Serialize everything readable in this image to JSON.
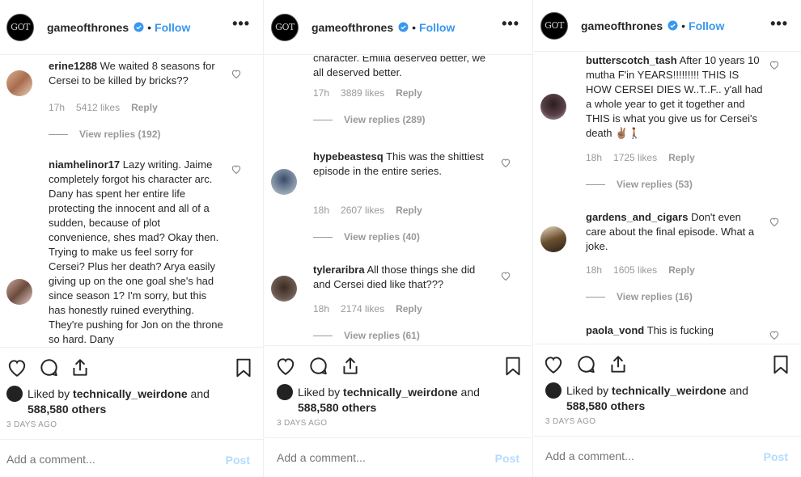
{
  "brand": {
    "logo_text": "GOT",
    "accent": "#3897f0"
  },
  "panels": [
    {
      "header": {
        "username": "gameofthrones",
        "separator": "•",
        "follow": "Follow",
        "more": "•••"
      },
      "comments": [
        {
          "user": "erine1288",
          "text": "We waited 8 seasons for Cersei to be killed by bricks??",
          "time": "17h",
          "likes": "5412 likes",
          "reply": "Reply",
          "replies": "View replies (192)"
        },
        {
          "user": "niamhelinor17",
          "text": "Lazy writing. Jaime completely forgot his character arc. Dany has spent her entire life protecting the innocent and all of a sudden, because of plot convenience, shes mad? Okay then. Trying to make us feel sorry for Cersei? Plus her death? Arya easily giving up on the one goal she's had since season 1? I'm sorry, but this has honestly ruined everything. They're pushing for Jon on the throne so hard. Dany"
        }
      ],
      "liked_prefix": "Liked by",
      "liked_user": "technically_weirdone",
      "liked_and": "and",
      "liked_others": "588,580 others",
      "ago": "3 DAYS AGO",
      "add_placeholder": "Add a comment...",
      "post": "Post"
    },
    {
      "header": {
        "username": "gameofthrones",
        "separator": "•",
        "follow": "Follow",
        "more": "•••"
      },
      "comments": [
        {
          "user": "",
          "text": "character. Emilia deserved better, we all deserved better.",
          "time": "17h",
          "likes": "3889 likes",
          "reply": "Reply",
          "replies": "View replies (289)"
        },
        {
          "user": "hypebeastesq",
          "text": "This was the shittiest episode in the entire series.",
          "time": "18h",
          "likes": "2607 likes",
          "reply": "Reply",
          "replies": "View replies (40)"
        },
        {
          "user": "tyleraribra",
          "text": "All those things she did and Cersei died like that???",
          "time": "18h",
          "likes": "2174 likes",
          "reply": "Reply",
          "replies": "View replies (61)"
        }
      ],
      "liked_prefix": "Liked by",
      "liked_user": "technically_weirdone",
      "liked_and": "and",
      "liked_others": "588,580 others",
      "ago": "3 DAYS AGO",
      "add_placeholder": "Add a comment...",
      "post": "Post"
    },
    {
      "header": {
        "username": "gameofthrones",
        "separator": "•",
        "follow": "Follow",
        "more": "•••"
      },
      "comments": [
        {
          "user": "butterscotch_tash",
          "text": "After 10 years 10 mutha F'in YEARS!!!!!!!!! THIS IS HOW CERSEI DIES W..T..F.. y'all had a whole year to get it together and THIS is what you give us for Cersei's death ✌🏽🚶🏽",
          "time": "18h",
          "likes": "1725 likes",
          "reply": "Reply",
          "replies": "View replies (53)"
        },
        {
          "user": "gardens_and_cigars",
          "text": "Don't even care about the final episode. What a joke.",
          "time": "18h",
          "likes": "1605 likes",
          "reply": "Reply",
          "replies": "View replies (16)"
        },
        {
          "user": "paola_vond",
          "text": "This is fucking"
        }
      ],
      "liked_prefix": "Liked by",
      "liked_user": "technically_weirdone",
      "liked_and": "and",
      "liked_others": "588,580 others",
      "ago": "3 DAYS AGO",
      "add_placeholder": "Add a comment...",
      "post": "Post"
    }
  ]
}
